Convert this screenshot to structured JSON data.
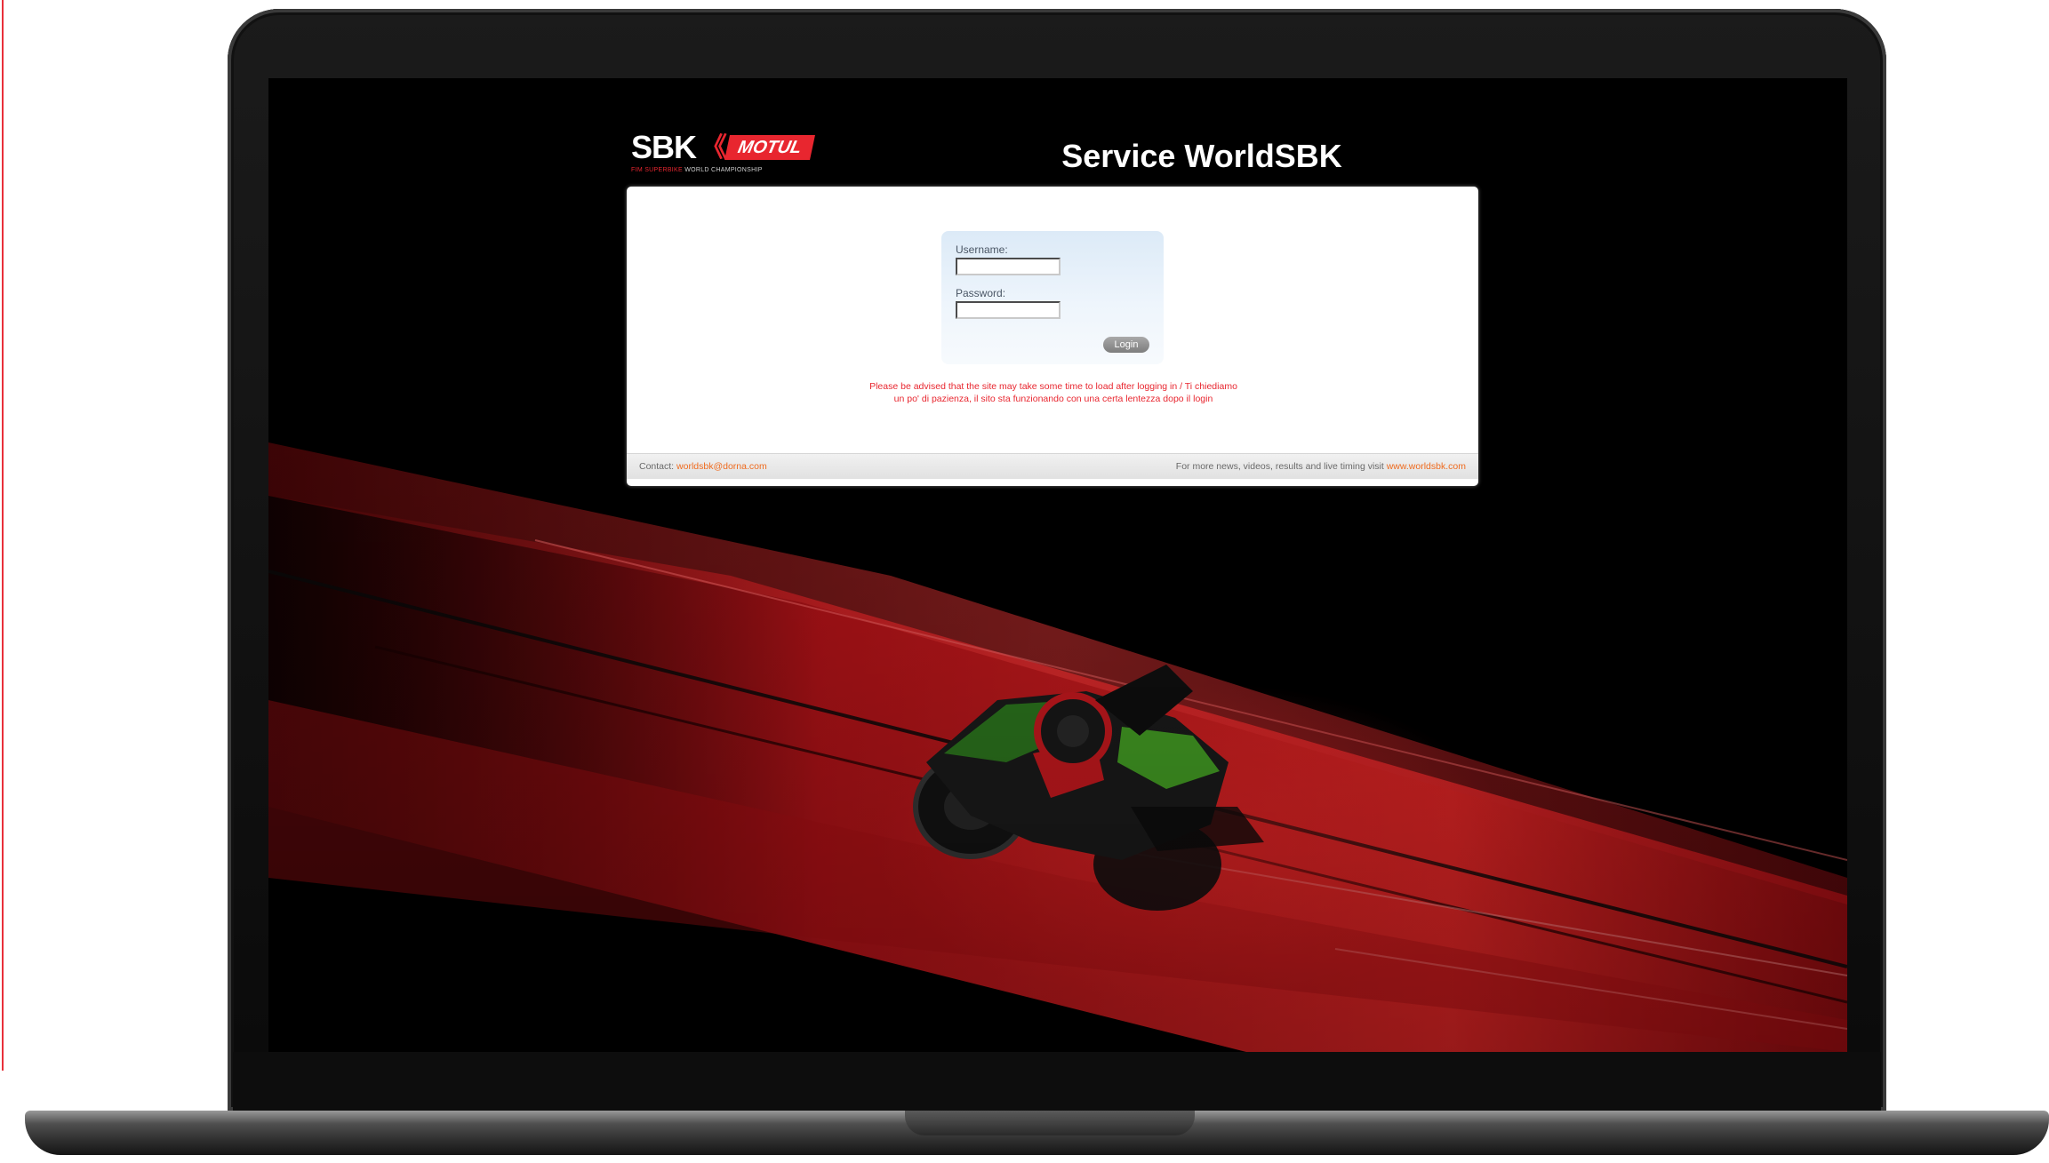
{
  "page": {
    "title": "Service WorldSBK",
    "logo": {
      "brand": "SBK",
      "chevrons": "《",
      "sponsor": "MOTUL",
      "tagline_red": "FIM SUPERBIKE",
      "tagline_white": " WORLD CHAMPIONSHIP"
    }
  },
  "login": {
    "username_label": "Username:",
    "username_value": "",
    "password_label": "Password:",
    "password_value": "",
    "button_label": "Login"
  },
  "notice": {
    "line1": "Please be advised that the site may take some time to load after logging in / Ti chiediamo",
    "line2": "un po' di pazienza, il sito sta funzionando con una certa lentezza dopo il login"
  },
  "footer": {
    "contact_label": "Contact: ",
    "contact_email": "worldsbk@dorna.com",
    "more_text": "For more news, videos, results and live timing visit ",
    "website": "www.worldsbk.com"
  },
  "colors": {
    "accent_red": "#e8262f",
    "link_orange": "#ef6b1f",
    "background": "#000000",
    "login_box": "#dceaf7"
  },
  "icons": {
    "hero": "motorbike-rider-image"
  }
}
